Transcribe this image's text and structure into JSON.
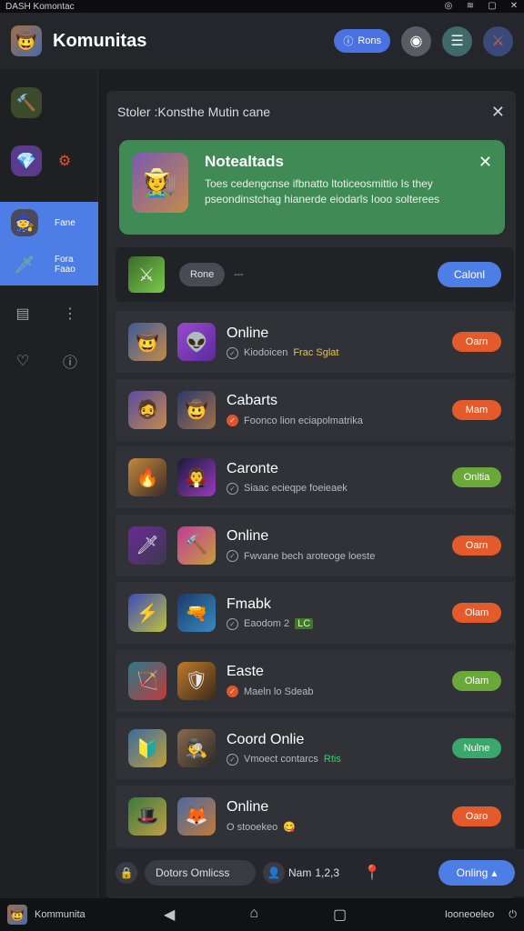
{
  "status_bar": {
    "left_text": "DASH Komontac",
    "icons": [
      "game-icon",
      "wifi-icon",
      "window-icon",
      "close-icon"
    ]
  },
  "app_bar": {
    "title": "Komunitas",
    "pill_label": "Rons"
  },
  "sidebar": {
    "selected_items": [
      {
        "label": "Fane"
      },
      {
        "label": "Fora\nFaao"
      }
    ]
  },
  "panel": {
    "title": "Stoler :Konsthe Mutin cane",
    "notice": {
      "title": "Notealtads",
      "text": "Toes cedengcnse ifbnatto ltoticeosmittio Is they pseondinstchag hianerde eiodarls Iooo solterees"
    },
    "search": {
      "chip": "Rone",
      "dash": "---",
      "button": "Calonl"
    },
    "rows": [
      {
        "title": "Online",
        "sub": "Kiodoicen",
        "sub_hl": "Frac Sglat",
        "badge": "Oarn",
        "badge_color": "orange"
      },
      {
        "title": "Cabarts",
        "sub": "Foonco lion eciapolmatrika",
        "badge": "Mam",
        "badge_color": "orange"
      },
      {
        "title": "Caronte",
        "sub": "Siaac ecieqpe foeieaek",
        "badge": "Onltia",
        "badge_color": "green"
      },
      {
        "title": "Online",
        "sub": "Fwvane bech aroteoge loeste",
        "badge": "Oarn",
        "badge_color": "orange"
      },
      {
        "title": "Fmabk",
        "sub": "Eaodom 2",
        "sub_tag": "LC",
        "badge": "Olam",
        "badge_color": "orange"
      },
      {
        "title": "Easte",
        "sub": "Maeln lo Sdeab",
        "badge": "Olam",
        "badge_color": "green"
      },
      {
        "title": "Coord Onlie",
        "sub": "Vmoect contarcs",
        "sub_hl_green": "Rtis",
        "badge": "Nulne",
        "badge_color": "teal"
      },
      {
        "title": "Online",
        "sub": "O stooekeo",
        "badge": "Oaro",
        "badge_color": "orange"
      }
    ]
  },
  "bottom_bar": {
    "input_placeholder": "Dotors Omlicss",
    "name_label": "Nam",
    "name_value": "1,2,3",
    "button": "Onling"
  },
  "nav_bar": {
    "app_name": "Kommunita",
    "right_text": "Iooneoeleo"
  },
  "colors": {
    "accent": "#4d7ee6",
    "notice_bg": "#3f8a55",
    "badge_orange": "#e55a2a",
    "badge_green": "#6aa83a"
  }
}
